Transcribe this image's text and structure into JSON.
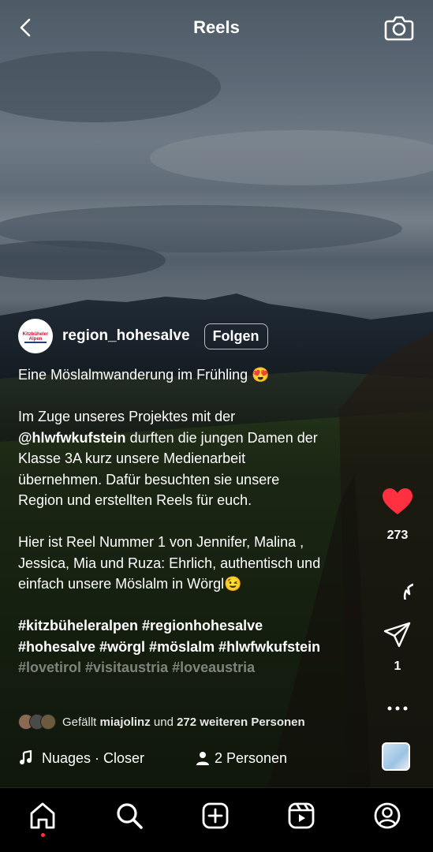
{
  "header": {
    "title": "Reels",
    "back_icon": "chevron-left-icon",
    "camera_icon": "camera-icon"
  },
  "author": {
    "username": "region_hohesalve",
    "follow_label": "Folgen",
    "avatar_text": "Kitzbüheler Alpen"
  },
  "caption": {
    "line1": "Eine Möslalmwanderung im Frühling 😍",
    "p2_l1": "Im Zuge unseres Projektes mit der",
    "p2_mention": "@hlwfwkufstein",
    "p2_l2": " durften die jungen Damen der",
    "p2_l3": "Klasse 3A kurz unsere Medienarbeit",
    "p2_l4": "übernehmen. Dafür besuchten sie unsere",
    "p2_l5": "Region und erstellten Reels für euch.",
    "p3_l1": "Hier ist Reel Nummer 1 von Jennifer, Malina ,",
    "p3_l2": "Jessica, Mia und Ruza: Ehrlich, authentisch und",
    "p3_l3": "einfach unsere Möslalm in Wörgl😉",
    "tags_l1": "#kitzbüheleralpen #regionhohesalve",
    "tags_l2": "#hohesalve #wörgl #möslalm #hlwfwkufstein",
    "tags_l3": "#lovetirol #visitaustria #loveaustria"
  },
  "likes": {
    "prefix": "Gefällt ",
    "user": "miajolinz",
    "middle": " und ",
    "others": "272 weiteren Personen"
  },
  "audio": {
    "track": "Nuages · Closer",
    "people": "2 Personen"
  },
  "actions": {
    "like_count": "273",
    "share_count": "1",
    "like_color": "#ff3040"
  },
  "tabs": [
    "home-icon",
    "search-icon",
    "create-icon",
    "reels-icon",
    "profile-icon"
  ]
}
